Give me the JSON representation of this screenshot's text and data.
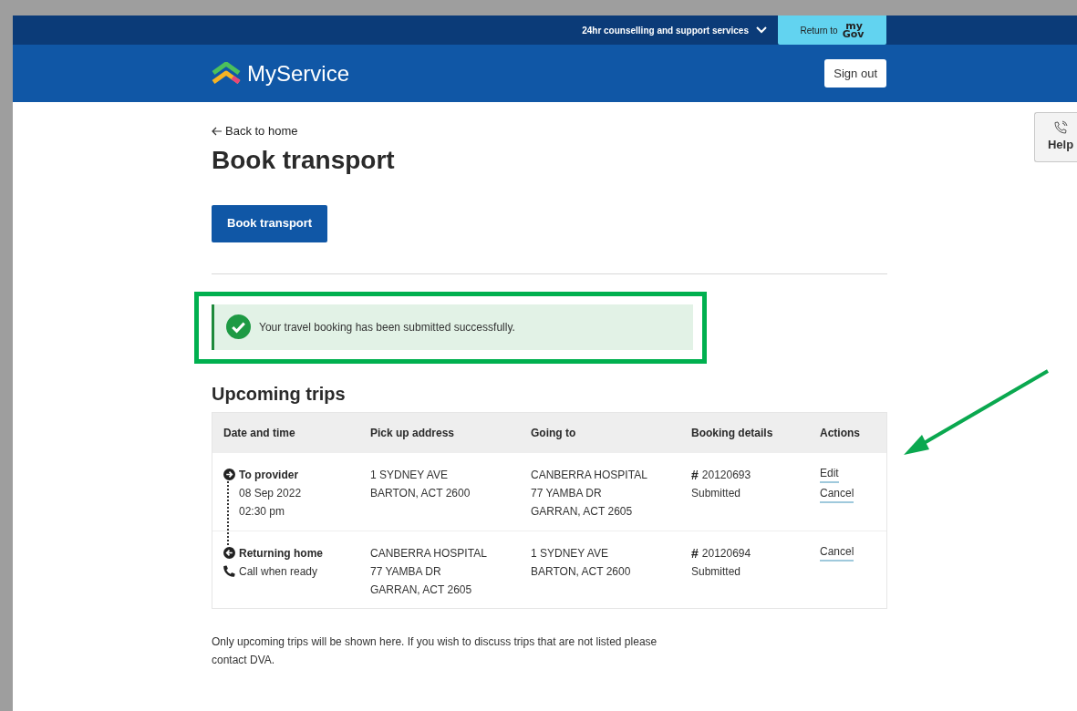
{
  "top_bar": {
    "support_menu": "24hr counselling and support services",
    "return_button": {
      "label": "Return to",
      "logo_top": "my",
      "logo_bottom": "Gov"
    }
  },
  "header": {
    "brand": "MyService",
    "sign_out": "Sign out"
  },
  "help_tab": {
    "label": "Help"
  },
  "back_link": "Back to home",
  "title": "Book transport",
  "primary_button": "Book transport",
  "alert": {
    "message": "Your travel booking has been submitted successfully.",
    "highlighted": true
  },
  "trips": {
    "heading": "Upcoming trips",
    "columns": [
      "Date and time",
      "Pick up address",
      "Going to",
      "Booking details",
      "Actions"
    ],
    "rows": [
      {
        "direction": {
          "kind": "outbound",
          "label": "To provider"
        },
        "when": [
          {
            "kind": "plain",
            "text": "08 Sep 2022"
          },
          {
            "kind": "plain",
            "text": "02:30 pm"
          }
        ],
        "pickup": [
          "1 SYDNEY AVE",
          "BARTON, ACT 2600"
        ],
        "destination": [
          "CANBERRA HOSPITAL",
          "77 YAMBA DR",
          "GARRAN, ACT 2605"
        ],
        "hash": "#",
        "booking_number": "20120693",
        "status": "Submitted",
        "actions": [
          "Edit",
          "Cancel"
        ]
      },
      {
        "direction": {
          "kind": "return",
          "label": "Returning home"
        },
        "when": [
          {
            "kind": "phone",
            "text": "Call when ready"
          }
        ],
        "pickup": [
          "CANBERRA HOSPITAL",
          "77 YAMBA DR",
          "GARRAN, ACT 2605"
        ],
        "destination": [
          "1 SYDNEY AVE",
          "BARTON, ACT 2600"
        ],
        "hash": "#",
        "booking_number": "20120694",
        "status": "Submitted",
        "actions": [
          "Cancel"
        ]
      }
    ]
  },
  "footnote": "Only upcoming trips will be shown here. If you wish to discuss trips that are not listed please contact DVA.",
  "annotation_arrow": true
}
